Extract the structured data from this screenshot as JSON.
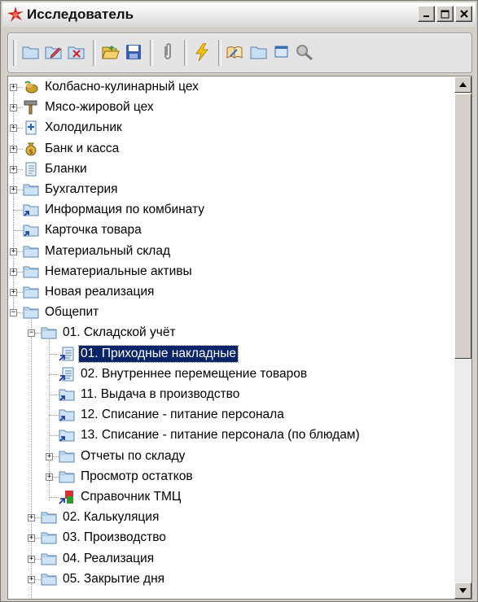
{
  "window": {
    "title": "Исследователь"
  },
  "tree": {
    "items": [
      {
        "label": "Колбасно-кулинарный цех",
        "icon": "sausage-icon",
        "expander": "+"
      },
      {
        "label": "Мясо-жировой цех",
        "icon": "hammer-icon",
        "expander": "+"
      },
      {
        "label": "Холодильник",
        "icon": "document-icon",
        "expander": "+"
      },
      {
        "label": "Банк и касса",
        "icon": "moneybag-icon",
        "expander": "+"
      },
      {
        "label": "Бланки",
        "icon": "form-icon",
        "expander": "+"
      },
      {
        "label": "Бухгалтерия",
        "icon": "folder-icon",
        "expander": "+"
      },
      {
        "label": "Информация по комбинату",
        "icon": "folder-shortcut-icon",
        "expander": ""
      },
      {
        "label": "Карточка товара",
        "icon": "folder-shortcut-icon",
        "expander": ""
      },
      {
        "label": "Материальный склад",
        "icon": "folder-icon",
        "expander": "+"
      },
      {
        "label": "Нематериальные активы",
        "icon": "folder-icon",
        "expander": "+"
      },
      {
        "label": "Новая реализация",
        "icon": "folder-icon",
        "expander": "+"
      },
      {
        "label": "Общепит",
        "icon": "folder-icon",
        "expander": "−"
      },
      {
        "label": "01. Складской учёт",
        "icon": "folder-icon",
        "expander": "−"
      },
      {
        "label": "01. Приходные накладные",
        "icon": "document-shortcut-icon",
        "expander": ""
      },
      {
        "label": "02. Внутреннее перемещение товаров",
        "icon": "document-shortcut-icon",
        "expander": ""
      },
      {
        "label": "11. Выдача в производство",
        "icon": "folder-shortcut-icon",
        "expander": ""
      },
      {
        "label": "12. Списание - питание персонала",
        "icon": "folder-shortcut-icon",
        "expander": ""
      },
      {
        "label": "13. Списание - питание персонала (по блюдам)",
        "icon": "folder-shortcut-icon",
        "expander": ""
      },
      {
        "label": "Отчеты по складу",
        "icon": "folder-icon",
        "expander": "+"
      },
      {
        "label": "Просмотр остатков",
        "icon": "folder-icon",
        "expander": "+"
      },
      {
        "label": "Справочник ТМЦ",
        "icon": "catalog-shortcut-icon",
        "expander": ""
      },
      {
        "label": "02. Калькуляция",
        "icon": "folder-icon",
        "expander": "+"
      },
      {
        "label": "03. Производство",
        "icon": "folder-icon",
        "expander": "+"
      },
      {
        "label": "04. Реализация",
        "icon": "folder-icon",
        "expander": "+"
      },
      {
        "label": "05. Закрытие дня",
        "icon": "folder-icon",
        "expander": "+"
      }
    ]
  }
}
